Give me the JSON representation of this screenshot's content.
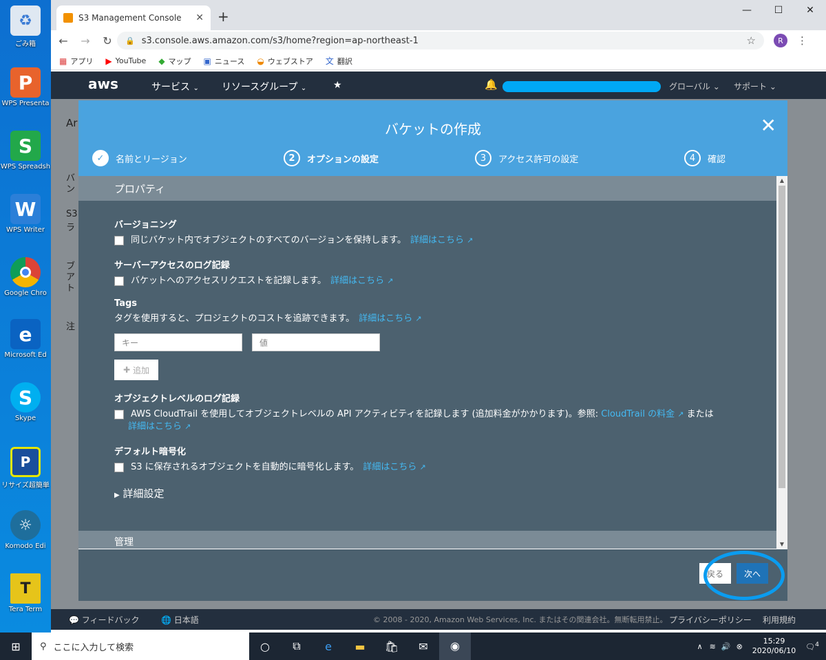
{
  "desktop": {
    "icons": [
      {
        "label": "ごみ箱",
        "icon": "recycle-bin-icon",
        "color": "#e8eef5"
      },
      {
        "label": "WPS Presenta",
        "icon": "wps-presentation-icon",
        "color": "#e8632c"
      },
      {
        "label": "WPS Spreadsh",
        "icon": "wps-spreadsheet-icon",
        "color": "#22a84a"
      },
      {
        "label": "WPS Writer",
        "icon": "wps-writer-icon",
        "color": "#2b7fd8"
      },
      {
        "label": "Google Chro",
        "icon": "chrome-icon",
        "color": "#ffffff"
      },
      {
        "label": "Microsoft Ed",
        "icon": "edge-icon",
        "color": "#0a63c2"
      },
      {
        "label": "Skype",
        "icon": "skype-icon",
        "color": "#00aff0"
      },
      {
        "label": "リサイズ超簡単",
        "icon": "resize-tool-icon",
        "color": "#2a6b2a"
      },
      {
        "label": "Komodo Edi",
        "icon": "komodo-edit-icon",
        "color": "#1e6e9c"
      },
      {
        "label": "Tera Term",
        "icon": "tera-term-icon",
        "color": "#e6c41a"
      }
    ]
  },
  "browser": {
    "tab_title": "S3 Management Console",
    "new_tab": "+",
    "url": "s3.console.aws.amazon.com/s3/home?region=ap-northeast-1",
    "avatar_letter": "R",
    "bookmarks": [
      "アプリ",
      "YouTube",
      "マップ",
      "ニュース",
      "ウェブストア",
      "翻訳"
    ]
  },
  "aws": {
    "logo": "aws",
    "services": "サービス",
    "resource_groups": "リソースグループ",
    "region": "グローバル",
    "support": "サポート",
    "page_partial": [
      "Ar",
      "バ",
      "ン",
      "S3",
      "ラ",
      "ブ",
      "ア",
      "ト",
      "注"
    ],
    "footer": {
      "feedback": "フィードバック",
      "language": "日本語",
      "copyright": "© 2008 - 2020, Amazon Web Services, Inc. またはその関連会社。無断転用禁止。",
      "privacy": "プライバシーポリシー",
      "terms": "利用規約"
    }
  },
  "modal": {
    "title": "バケットの作成",
    "steps": [
      {
        "num": "✓",
        "label": "名前とリージョン"
      },
      {
        "num": "2",
        "label": "オプションの設定"
      },
      {
        "num": "3",
        "label": "アクセス許可の設定"
      },
      {
        "num": "4",
        "label": "確認"
      }
    ],
    "section_properties": "プロパティ",
    "versioning": {
      "title": "バージョニング",
      "text": "同じバケット内でオブジェクトのすべてのバージョンを保持します。",
      "link": "詳細はこちら"
    },
    "server_access_log": {
      "title": "サーバーアクセスのログ記録",
      "text": "バケットへのアクセスリクエストを記録します。",
      "link": "詳細はこちら"
    },
    "tags": {
      "title": "Tags",
      "text": "タグを使用すると、プロジェクトのコストを追跡できます。",
      "link": "詳細はこちら",
      "key_placeholder": "キー",
      "value_placeholder": "値",
      "add": "追加"
    },
    "object_log": {
      "title": "オブジェクトレベルのログ記録",
      "text": "AWS CloudTrail を使用してオブジェクトレベルの API アクティビティを記録します (追加料金がかかります)。参照: ",
      "link1": "CloudTrail の料金",
      "or": "または",
      "link2": "詳細はこちら"
    },
    "encryption": {
      "title": "デフォルト暗号化",
      "text": "S3 に保存されるオブジェクトを自動的に暗号化します。",
      "link": "詳細はこちら"
    },
    "advanced": "詳細設定",
    "section_management": "管理",
    "back": "戻る",
    "next": "次へ"
  },
  "taskbar": {
    "search_placeholder": "ここに入力して検索",
    "time": "15:29",
    "date": "2020/06/10",
    "notifications": "4"
  }
}
